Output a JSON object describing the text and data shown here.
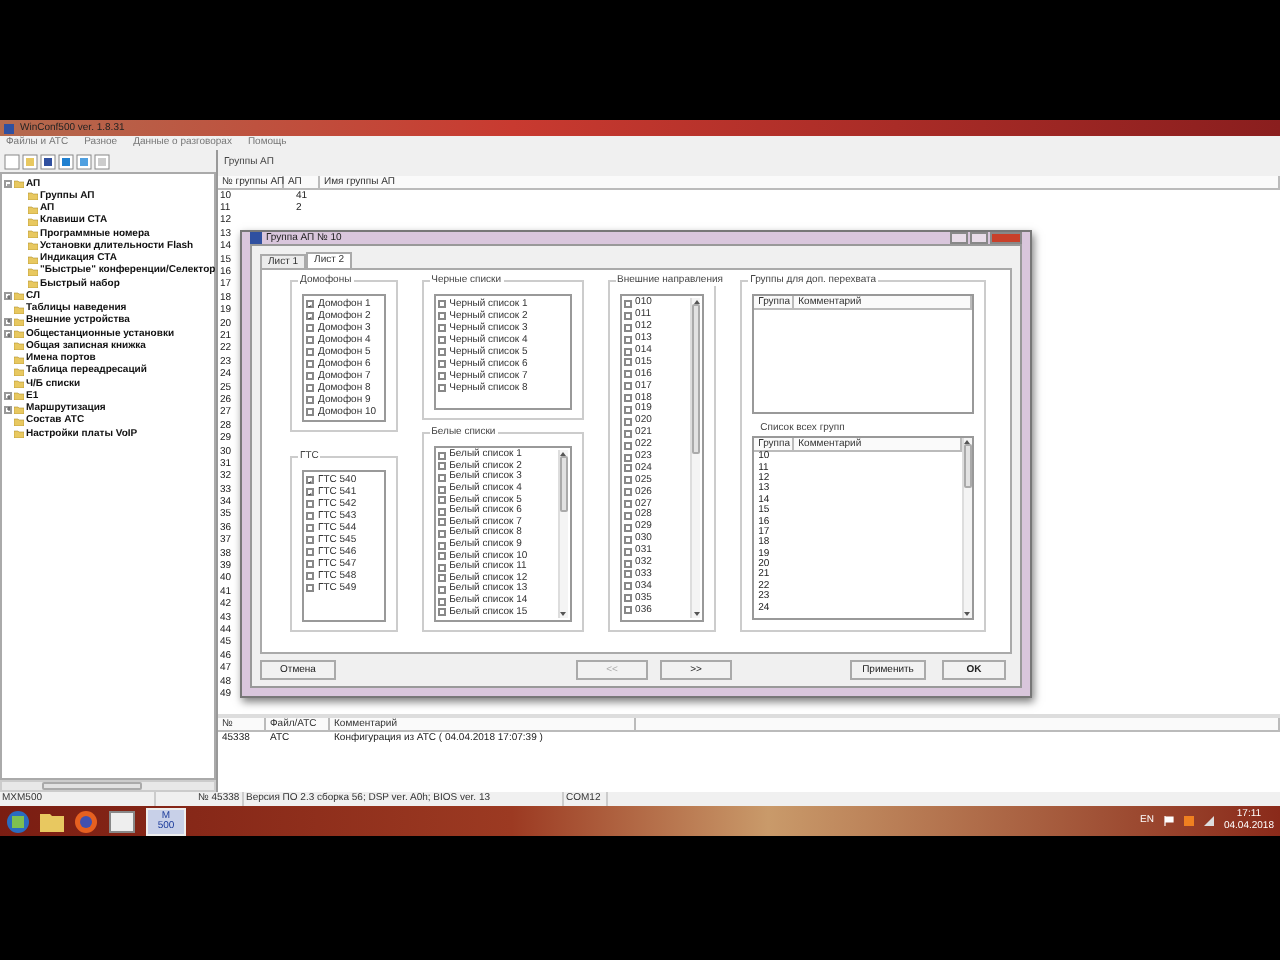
{
  "window": {
    "title": "WinConf500  ver. 1.8.31"
  },
  "menu": [
    "Файлы и АТС",
    "Разное",
    "Данные о разговорах",
    "Помощь"
  ],
  "tree": [
    {
      "label": "АП",
      "expanded": true,
      "children": [
        {
          "label": "Группы АП"
        },
        {
          "label": "АП"
        },
        {
          "label": "Клавиши СТА"
        },
        {
          "label": "Программные номера"
        },
        {
          "label": "Установки длительности Flash"
        },
        {
          "label": "Индикация СТА"
        },
        {
          "label": "\"Быстрые\" конференции/Селектор"
        },
        {
          "label": "Быстрый набор"
        }
      ]
    },
    {
      "label": "СЛ",
      "expanded": false
    },
    {
      "label": "Таблицы наведения"
    },
    {
      "label": "Внешние устройства",
      "expanded": false
    },
    {
      "label": "Общестанционные установки",
      "expanded": false
    },
    {
      "label": "Общая записная книжка"
    },
    {
      "label": "Имена портов"
    },
    {
      "label": "Таблица переадресаций"
    },
    {
      "label": "Ч/Б списки"
    },
    {
      "label": "E1",
      "expanded": false
    },
    {
      "label": "Маршрутизация",
      "expanded": false
    },
    {
      "label": "Состав АТС"
    },
    {
      "label": "Настройки платы VoIP"
    }
  ],
  "main_pane": {
    "title": "Группы АП",
    "columns": [
      "№ группы АП",
      "АП",
      "Имя группы АП"
    ],
    "rows": [
      [
        "10",
        "41"
      ],
      [
        "11",
        "2"
      ],
      [
        "12"
      ],
      [
        "13"
      ],
      [
        "14"
      ],
      [
        "15"
      ],
      [
        "16"
      ],
      [
        "17"
      ],
      [
        "18"
      ],
      [
        "19"
      ],
      [
        "20"
      ],
      [
        "21"
      ],
      [
        "22"
      ],
      [
        "23"
      ],
      [
        "24"
      ],
      [
        "25"
      ],
      [
        "26"
      ],
      [
        "27"
      ],
      [
        "28"
      ],
      [
        "29"
      ],
      [
        "30"
      ],
      [
        "31"
      ],
      [
        "32"
      ],
      [
        "33"
      ],
      [
        "34"
      ],
      [
        "35"
      ],
      [
        "36"
      ],
      [
        "37"
      ],
      [
        "38"
      ],
      [
        "39"
      ],
      [
        "40"
      ],
      [
        "41"
      ],
      [
        "42"
      ],
      [
        "43"
      ],
      [
        "44"
      ],
      [
        "45"
      ],
      [
        "46"
      ],
      [
        "47"
      ],
      [
        "48"
      ],
      [
        "49"
      ]
    ]
  },
  "log_table": {
    "columns": [
      "№",
      "Файл/АТС",
      "Комментарий"
    ],
    "rows": [
      [
        "45338",
        "АТС",
        "Конфигурация из АТС ( 04.04.2018 17:07:39 )"
      ]
    ]
  },
  "status_bar": [
    "MXM500",
    "№ 45338",
    "Версия ПО 2.3 сборка 56; DSP ver. A0h; BIOS ver. 13",
    "COM12"
  ],
  "taskbar": {
    "logo": [
      "M",
      "500"
    ],
    "language": "EN",
    "time": "17:11",
    "date": "04.04.2018"
  },
  "dialog": {
    "title": "Группа АП № 10",
    "tabs": [
      {
        "label": "Лист 1",
        "selected": false
      },
      {
        "label": "Лист 2",
        "selected": true
      }
    ],
    "intercoms": {
      "title": "Домофоны",
      "items": [
        {
          "label": "Домофон 1",
          "checked": true
        },
        {
          "label": "Домофон 2",
          "checked": true
        },
        {
          "label": "Домофон 3",
          "checked": false
        },
        {
          "label": "Домофон 4",
          "checked": false
        },
        {
          "label": "Домофон 5",
          "checked": false
        },
        {
          "label": "Домофон 6",
          "checked": false
        },
        {
          "label": "Домофон 7",
          "checked": false
        },
        {
          "label": "Домофон 8",
          "checked": false
        },
        {
          "label": "Домофон 9",
          "checked": false
        },
        {
          "label": "Домофон 10",
          "checked": false
        }
      ]
    },
    "gts": {
      "title": "ГТС",
      "items": [
        {
          "label": "ГТС 540",
          "checked": true
        },
        {
          "label": "ГТС 541",
          "checked": true
        },
        {
          "label": "ГТС 542",
          "checked": false
        },
        {
          "label": "ГТС 543",
          "checked": false
        },
        {
          "label": "ГТС 544",
          "checked": false
        },
        {
          "label": "ГТС 545",
          "checked": false
        },
        {
          "label": "ГТС 546",
          "checked": false
        },
        {
          "label": "ГТС 547",
          "checked": false
        },
        {
          "label": "ГТС 548",
          "checked": false
        },
        {
          "label": "ГТС 549",
          "checked": false
        }
      ]
    },
    "black_lists": {
      "title": "Черные списки",
      "items": [
        {
          "label": "Черный список 1",
          "checked": false
        },
        {
          "label": "Черный список 2",
          "checked": false
        },
        {
          "label": "Черный список 3",
          "checked": false
        },
        {
          "label": "Черный список 4",
          "checked": false
        },
        {
          "label": "Черный список 5",
          "checked": false
        },
        {
          "label": "Черный список 6",
          "checked": false
        },
        {
          "label": "Черный список 7",
          "checked": false
        },
        {
          "label": "Черный список 8",
          "checked": false
        }
      ]
    },
    "white_lists": {
      "title": "Белые списки",
      "items": [
        {
          "label": "Белый список 1",
          "checked": false
        },
        {
          "label": "Белый список 2",
          "checked": false
        },
        {
          "label": "Белый список 3",
          "checked": false
        },
        {
          "label": "Белый список 4",
          "checked": false
        },
        {
          "label": "Белый список 5",
          "checked": false
        },
        {
          "label": "Белый список 6",
          "checked": false
        },
        {
          "label": "Белый список 7",
          "checked": false
        },
        {
          "label": "Белый список 8",
          "checked": false
        },
        {
          "label": "Белый список 9",
          "checked": false
        },
        {
          "label": "Белый список 10",
          "checked": false
        },
        {
          "label": "Белый список 11",
          "checked": false
        },
        {
          "label": "Белый список 12",
          "checked": false
        },
        {
          "label": "Белый список 13",
          "checked": false
        },
        {
          "label": "Белый список 14",
          "checked": false
        },
        {
          "label": "Белый список 15",
          "checked": false
        }
      ]
    },
    "external_directions": {
      "title": "Внешние направления",
      "items": [
        {
          "label": "010",
          "checked": false
        },
        {
          "label": "011",
          "checked": false
        },
        {
          "label": "012",
          "checked": false
        },
        {
          "label": "013",
          "checked": false
        },
        {
          "label": "014",
          "checked": false
        },
        {
          "label": "015",
          "checked": false
        },
        {
          "label": "016",
          "checked": false
        },
        {
          "label": "017",
          "checked": false
        },
        {
          "label": "018",
          "checked": false
        },
        {
          "label": "019",
          "checked": false
        },
        {
          "label": "020",
          "checked": false
        },
        {
          "label": "021",
          "checked": false
        },
        {
          "label": "022",
          "checked": false
        },
        {
          "label": "023",
          "checked": false
        },
        {
          "label": "024",
          "checked": false
        },
        {
          "label": "025",
          "checked": false
        },
        {
          "label": "026",
          "checked": false
        },
        {
          "label": "027",
          "checked": false
        },
        {
          "label": "028",
          "checked": false
        },
        {
          "label": "029",
          "checked": false
        },
        {
          "label": "030",
          "checked": false
        },
        {
          "label": "031",
          "checked": false
        },
        {
          "label": "032",
          "checked": false
        },
        {
          "label": "033",
          "checked": false
        },
        {
          "label": "034",
          "checked": false
        },
        {
          "label": "035",
          "checked": false
        },
        {
          "label": "036",
          "checked": false
        }
      ]
    },
    "pickup_groups": {
      "title": "Группы для доп. перехвата",
      "columns": [
        "Группа",
        "Комментарий"
      ],
      "all_groups_title": "Список всех групп",
      "all_groups_columns": [
        "Группа",
        "Комментарий"
      ],
      "all_groups": [
        "10",
        "11",
        "12",
        "13",
        "14",
        "15",
        "16",
        "17",
        "18",
        "19",
        "20",
        "21",
        "22",
        "23",
        "24"
      ]
    },
    "buttons": [
      {
        "label": "Отмена",
        "disabled": false
      },
      {
        "label": "<<",
        "disabled": true
      },
      {
        "label": ">>",
        "disabled": false
      },
      {
        "label": "Применить",
        "disabled": false
      },
      {
        "label": "OK",
        "disabled": false
      }
    ]
  }
}
